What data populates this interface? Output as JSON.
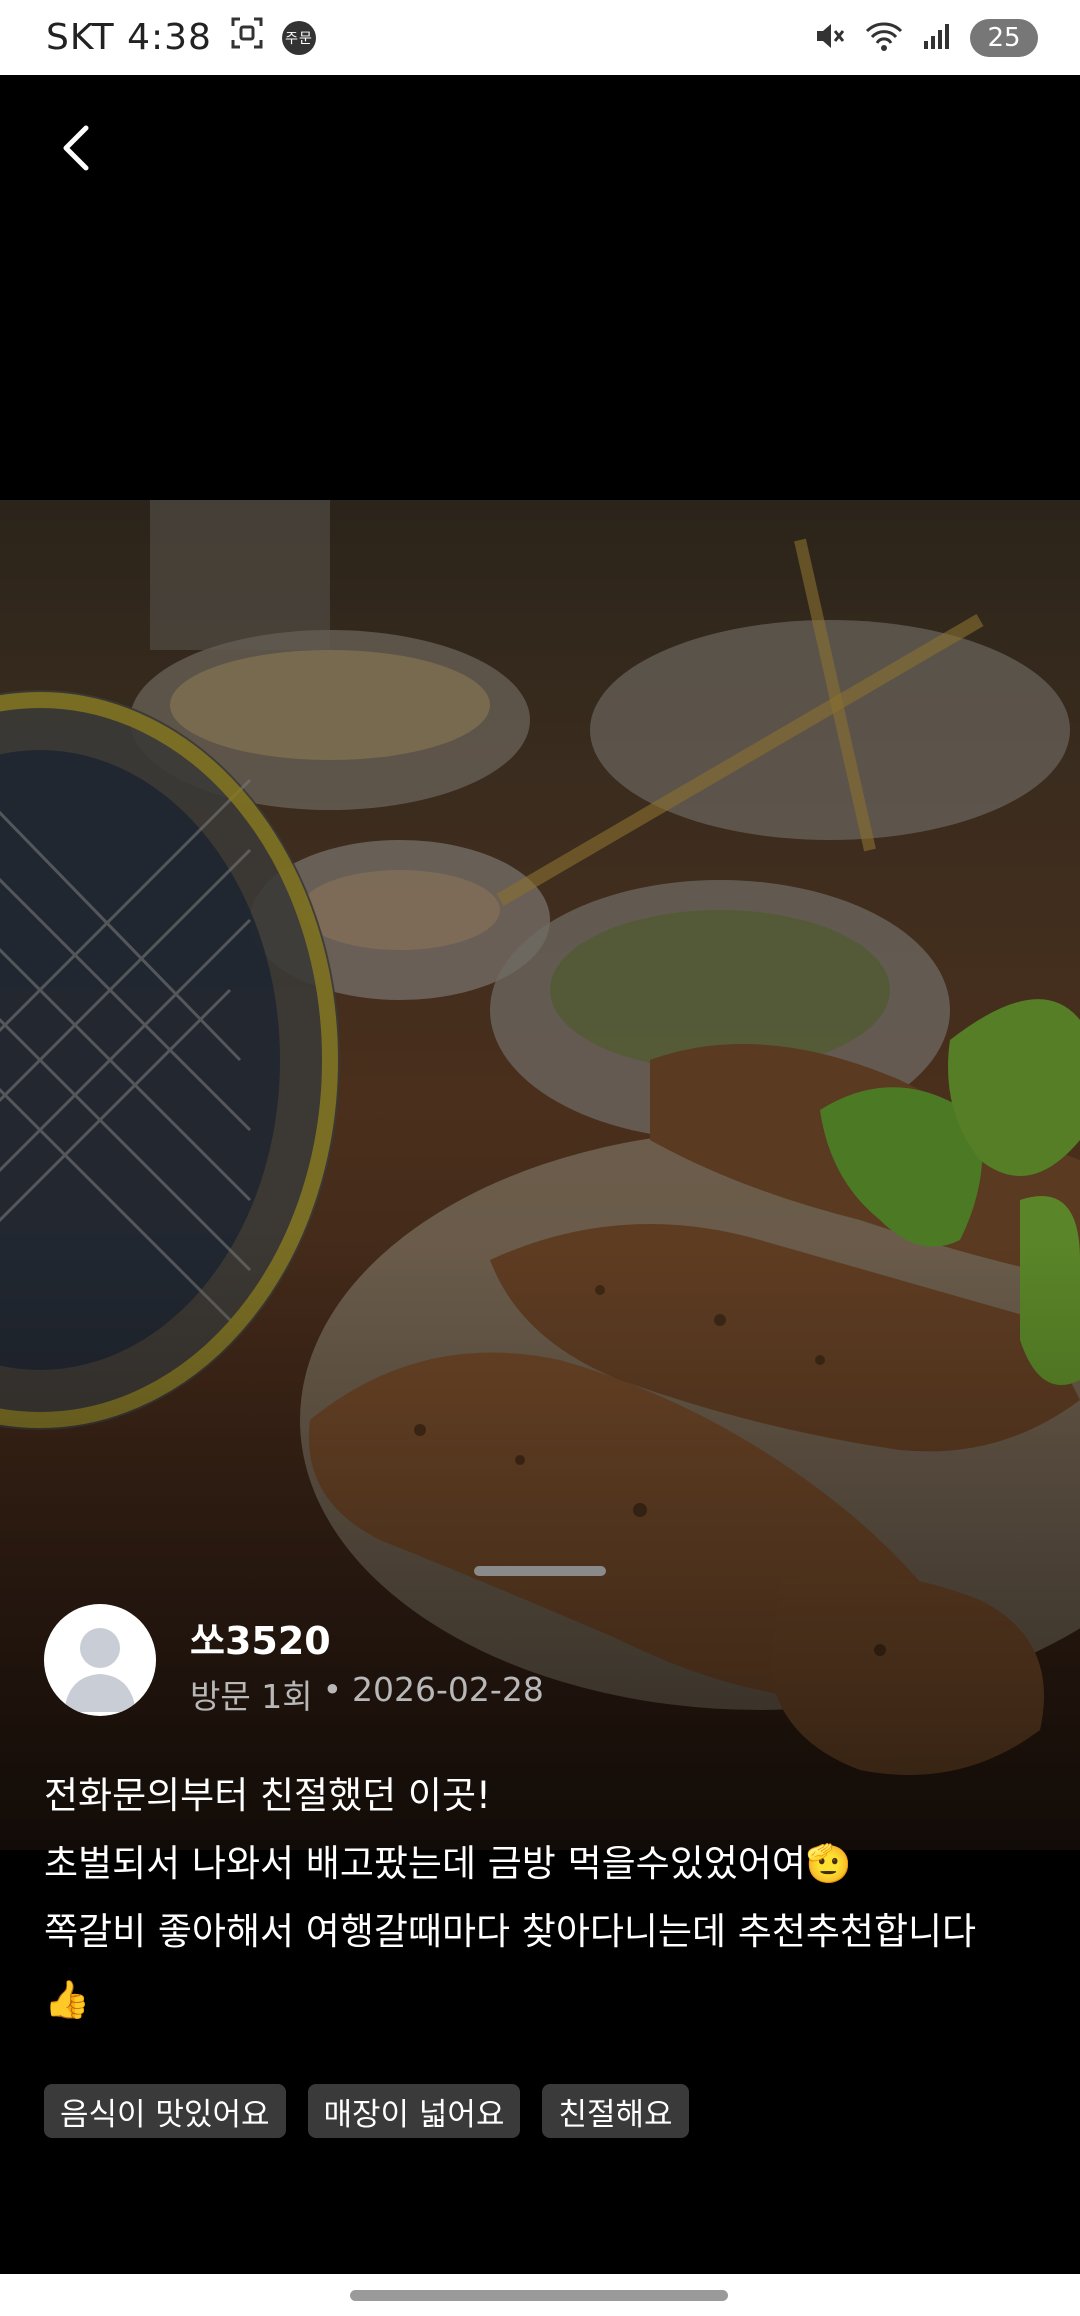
{
  "status_bar": {
    "carrier_time": "SKT 4:38",
    "badge": "주문",
    "battery": "25",
    "icons": [
      "screenshot-icon",
      "mute-icon",
      "wifi-icon",
      "signal-icon"
    ]
  },
  "header": {
    "back_icon": "chevron-left-icon"
  },
  "photo": {
    "description_icon": "food-photo"
  },
  "review": {
    "username": "쏘3520",
    "visits": "방문 1회",
    "separator": "•",
    "date": "2026-02-28",
    "lines": [
      "전화문의부터 친절했던 이곳!",
      "초벌되서 나와서 배고팠는데 금방 먹을수있었어여🫡",
      "쪽갈비 좋아해서 여행갈때마다 찾아다니는데 추천추천합니다",
      "👍"
    ]
  },
  "tags": [
    "음식이 맛있어요",
    "매장이 넓어요",
    "친절해요"
  ],
  "colors": {
    "background": "#000000",
    "tag_bg": "#3a3a3a",
    "meta_text": "#b8b8b8"
  }
}
